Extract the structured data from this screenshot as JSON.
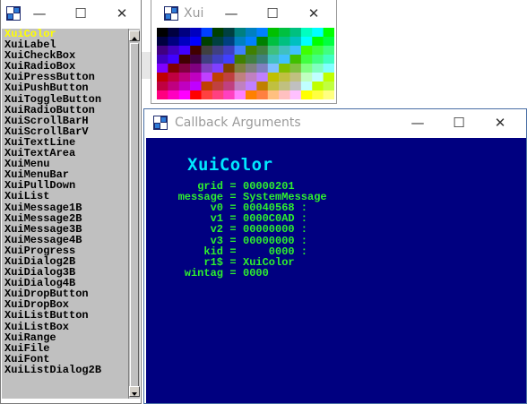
{
  "list_window": {
    "items": [
      "XuiColor",
      "XuiLabel",
      "XuiCheckBox",
      "XuiRadioBox",
      "XuiPressButton",
      "XuiPushButton",
      "XuiToggleButton",
      "XuiRadioButton",
      "XuiScrollBarH",
      "XuiScrollBarV",
      "XuiTextLine",
      "XuiTextArea",
      "XuiMenu",
      "XuiMenuBar",
      "XuiPullDown",
      "XuiList",
      "XuiMessage1B",
      "XuiMessage2B",
      "XuiMessage3B",
      "XuiMessage4B",
      "XuiProgress",
      "XuiDialog2B",
      "XuiDialog3B",
      "XuiDialog4B",
      "XuiDropButton",
      "XuiDropBox",
      "XuiListButton",
      "XuiListBox",
      "XuiRange",
      "XuiFile",
      "XuiFont",
      "XuiListDialog2B"
    ],
    "selected_index": 0,
    "minimize_glyph": "—",
    "maximize_glyph": "☐",
    "close_glyph": "✕"
  },
  "palette_window": {
    "title": "Xui",
    "minimize_glyph": "—",
    "maximize_glyph": "☐",
    "close_glyph": "✕"
  },
  "callback_window": {
    "title": "Callback Arguments",
    "heading": "XuiColor",
    "minimize_glyph": "—",
    "maximize_glyph": "☐",
    "close_glyph": "✕",
    "rows": [
      {
        "label": "grid",
        "value": "00000201"
      },
      {
        "label": "message",
        "value": "SystemMessage"
      },
      {
        "label": "v0",
        "value": "00040568 :"
      },
      {
        "label": "v1",
        "value": "0000C0AD :"
      },
      {
        "label": "v2",
        "value": "00000000 :"
      },
      {
        "label": "v3",
        "value": "00000000 :"
      },
      {
        "label": "kid",
        "value": "    0000 :"
      },
      {
        "label": "r1$",
        "value": "XuiColor"
      },
      {
        "label": "wintag",
        "value": "0000"
      }
    ]
  },
  "colors": {
    "selected_text": "#ffff00",
    "callback_bg": "#000080",
    "callback_text": "#2ef02e",
    "heading_text": "#00e8ff"
  }
}
